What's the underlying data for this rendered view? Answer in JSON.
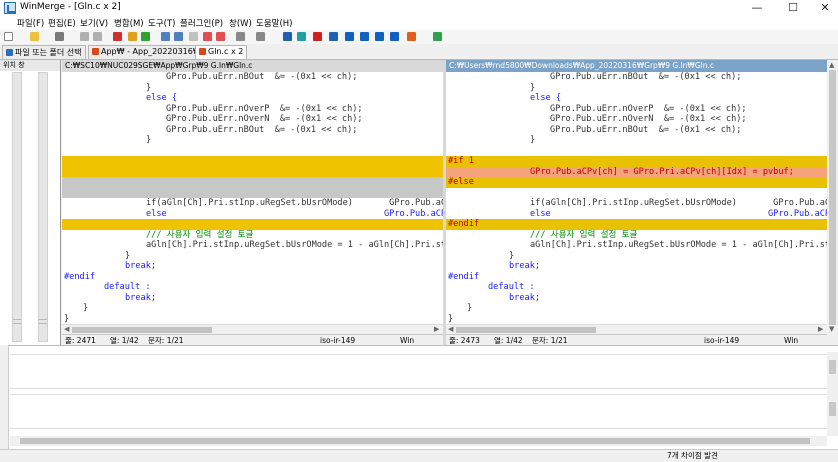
{
  "window": {
    "title": "WinMerge - [Gln.c x 2]",
    "minimize": "—",
    "maximize": "☐",
    "close": "✕"
  },
  "menu": [
    "파일(F)",
    "편집(E)",
    "보기(V)",
    "병합(M)",
    "도구(T)",
    "플러그인(P)",
    "창(W)",
    "도움말(H)"
  ],
  "tabs": [
    {
      "label": "파일 또는 폴더 선택",
      "icon_color": "#2b6fb8"
    },
    {
      "label": "App₩ - App_20220316₩",
      "icon_color": "#d94a1a"
    },
    {
      "label": "Gln.c x 2",
      "icon_color": "#d94a1a"
    }
  ],
  "location_pane": {
    "title": "위치 창"
  },
  "left_pane": {
    "path": "C:₩SC10₩NUC029SGE₩App₩Grp₩9 G.ln₩Gln.c",
    "status": {
      "line": "줄: 2471",
      "col": "열: 1/42",
      "char": "문자: 1/21",
      "encoding": "iso-ir-149",
      "eol": "Win"
    }
  },
  "right_pane": {
    "path": "C:₩Users₩rnd5800₩Downloads₩App_20220316₩Grp₩9 G.ln₩Gln.c",
    "status": {
      "line": "줄: 2473",
      "col": "열: 1/42",
      "char": "문자: 1/21",
      "encoding": "iso-ir-149",
      "eol": "Win"
    }
  },
  "code": {
    "l1": "GPro.Pub.uErr.nBOut  &= -(0x1 << ch);",
    "l2": "}",
    "l3": "else {",
    "l4": "GPro.Pub.uErr.nOverP  &= -(0x1 << ch);",
    "l5": "GPro.Pub.uErr.nOverN  &= -(0x1 << ch);",
    "l6": "GPro.Pub.uErr.nBOut  &= -(0x1 << ch);",
    "l7": "}",
    "if1": "#if 1",
    "assign": "GPro.Pub.aCPv[ch] = GPro.Pri.aCPv[ch][Idx] = pvbuf;",
    "else_pp": "#else",
    "if_line": "if(aGln[Ch].Pri.stInp.uRegSet.bUsrOMode)       GPro.Pub.aCPv",
    "else_line": "else                                          GPro.Pub.aCPv",
    "endif_pp": "#endif",
    "comment": "/// 사용자 입력 설정 토글",
    "toggle": "aGln[Ch].Pri.stInp.uRegSet.bUsrOMode = 1 - aGln[Ch].Pri.st",
    "brace": "}",
    "break": "break;",
    "endif2": "#endif",
    "default": "default :",
    "break2": "break;",
    "brace2": "}",
    "brace3": "}",
    "doc": "/**"
  },
  "statusbar": {
    "message": "7개 차이점 발견"
  }
}
